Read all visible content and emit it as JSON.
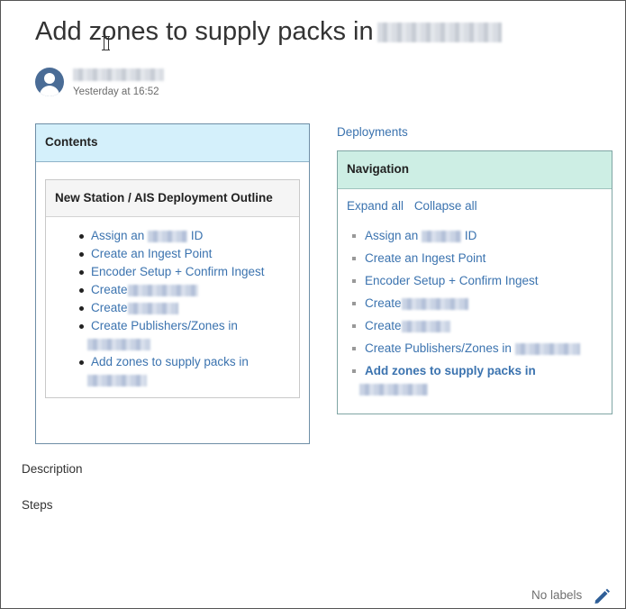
{
  "page": {
    "title": "Add zones to supply packs in",
    "author_timestamp": "Yesterday at 16:52"
  },
  "contents": {
    "header": "Contents",
    "outline_title": "New Station / AIS Deployment Outline",
    "items": [
      {
        "pre": "Assign an",
        "post": "ID"
      },
      {
        "pre": "Create an Ingest Point"
      },
      {
        "pre": "Encoder Setup + Confirm Ingest"
      },
      {
        "pre": "Create"
      },
      {
        "pre": "Create"
      },
      {
        "pre": "Create Publishers/Zones in"
      },
      {
        "pre": "Add zones to supply packs in"
      }
    ]
  },
  "navigation": {
    "parent_link": "Deployments",
    "header": "Navigation",
    "expand_all": "Expand all",
    "collapse_all": "Collapse all",
    "items": [
      {
        "pre": "Assign an",
        "post": "ID"
      },
      {
        "pre": "Create an Ingest Point"
      },
      {
        "pre": "Encoder Setup + Confirm Ingest"
      },
      {
        "pre": "Create"
      },
      {
        "pre": "Create"
      },
      {
        "pre": "Create Publishers/Zones in"
      },
      {
        "pre": "Add zones to supply packs in",
        "current": true
      }
    ]
  },
  "sections": {
    "description": "Description",
    "steps": "Steps"
  },
  "footer": {
    "labels": "No labels"
  },
  "icons": {
    "avatar": "user-avatar-icon",
    "edit": "pencil-icon"
  },
  "colors": {
    "link": "#3b73af",
    "contents_header_bg": "#d4f0fb",
    "navigation_header_bg": "#cdeee4",
    "avatar": "#4a6c96"
  }
}
